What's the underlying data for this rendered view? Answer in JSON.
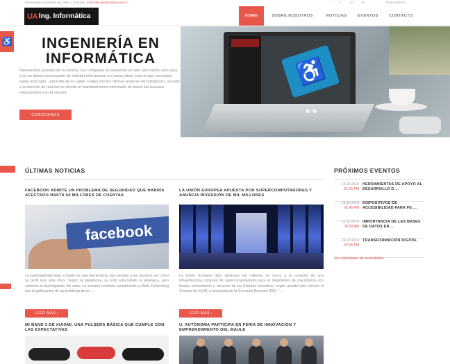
{
  "topbar": {
    "university": "Universidad Autónoma de Chile",
    "email_prefix": "✉ Email :",
    "email": "informaticaite@uautonoma.cl",
    "social": [
      "f",
      "t",
      "in",
      "✉"
    ],
    "portal": "Portal Alumno"
  },
  "logo": {
    "mark": "UA",
    "name": "Ing. Informática"
  },
  "nav": {
    "items": [
      {
        "label": "HOME"
      },
      {
        "label": "SOBRE NOSOTROS"
      },
      {
        "label": "NOTICIAS"
      },
      {
        "label": "EVENTOS"
      },
      {
        "label": "CONTACTO"
      }
    ]
  },
  "hero": {
    "title_line1": "INGENIERÍA EN",
    "title_line2": "INFORMÁTICA",
    "text": "Bienvenidos jóvenes de la carrera, nos complace en presentar un sitio web hecho solo para ti,ya no debes preocuparte de solicitar información en varios sitios, todo lo que necesitas saber está aquí. ¡aburrido de no saber cuales son los últimos avances tecnológicos?, accede a la sección de noticias en donde te mantendremos informado de todos los sucesos relacionados con la carrera.",
    "button": "CONOCENOS"
  },
  "news": {
    "heading": "ÚLTIMAS NOTICIAS",
    "items": [
      {
        "title": "FACEBOOK ADMITE UN PROBLEMA DE SEGURIDAD QUE HABRÍA AFECTADO HASTA 50 MILLONES DE CUENTAS",
        "image_label": "facebook",
        "text": "La vulnerabilidad llega a través de una herramienta que permite a los usuarios ver cómo su perfil luce ante otros. Según la plataforma, ya está solucionado la amenaza, pero continúa la investigación del caso. La semana continúa complicando a Mark Zuckerberg tras la publicación de un problema de se ...",
        "button": "LEER MÁS ›"
      },
      {
        "title": "LA UNIÓN EUROPEA APUESTA POR SUPERCOMPUTADORES Y ANUNCIA INVERSIÓN DE MIL MILLONES",
        "text": "La Unión Europea (UE) destinará mil millones de euros a la creación de una infraestructura conjunta de supercomputadores para el tratamiento de macrodatos con fondos comunitarios y recursos de los Estados miembros, según acordó este viernes el Consejo de la UE, a propuesta de la Comisión Europea (CE). \" ...",
        "button": "LEER MÁS ›"
      },
      {
        "title": "MI BAND 3 DE XIAOMI, UNA PULSERA BÁSICA QUE CUMPLE CON LAS EXPECTATIVAS"
      },
      {
        "title": "U. AUTÓNOMA PARTICIPA EN FERIA DE INNOVACIÓN Y EMPRENDIMIENTO DEL MAULE"
      }
    ]
  },
  "events": {
    "heading": "PRÓXIMOS EVENTOS",
    "items": [
      {
        "date": "16.10.2018",
        "time": "01:25 PM",
        "title": "HERRAMIENTAS DE APOYO AL DESARROLLO D ..."
      },
      {
        "date": "16.10.2018",
        "time": "01:45 PM",
        "title": "DISPOSITIVOS DE ACCESIBILIDAD PARA PE ..."
      },
      {
        "date": "16.10.2018",
        "time": "10:39 AM",
        "title": "IMPORTANCIA DE LAS BASES DE DATOS EN ..."
      },
      {
        "date": "24.10.2018",
        "time": "02:36 PM",
        "title": "TRANSFORMACIÓN DIGITAL"
      }
    ],
    "all_link": "Ver calendario de actividades"
  },
  "colors": {
    "accent": "#e8574a",
    "facebook": "#3b5ba5"
  }
}
